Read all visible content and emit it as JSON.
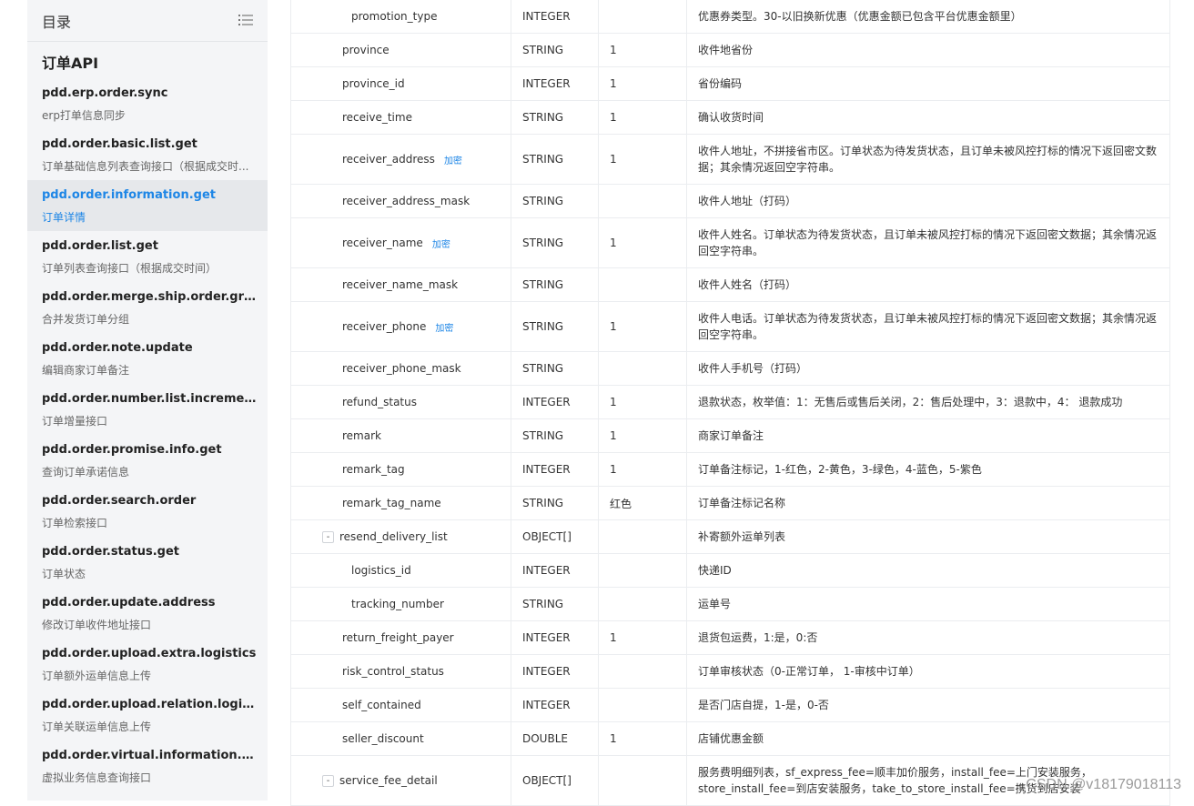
{
  "sidebar": {
    "title": "目录",
    "toc_icon": "list-icon",
    "group_title": "订单API",
    "items": [
      {
        "name": "pdd.erp.order.sync",
        "desc": "erp打单信息同步",
        "active": false
      },
      {
        "name": "pdd.order.basic.list.get",
        "desc": "订单基础信息列表查询接口（根据成交时...",
        "active": false
      },
      {
        "name": "pdd.order.information.get",
        "desc": "订单详情",
        "active": true
      },
      {
        "name": "pdd.order.list.get",
        "desc": "订单列表查询接口（根据成交时间）",
        "active": false
      },
      {
        "name": "pdd.order.merge.ship.order.group",
        "desc": "合并发货订单分组",
        "active": false
      },
      {
        "name": "pdd.order.note.update",
        "desc": "编辑商家订单备注",
        "active": false
      },
      {
        "name": "pdd.order.number.list.increment....",
        "desc": "订单增量接口",
        "active": false
      },
      {
        "name": "pdd.order.promise.info.get",
        "desc": "查询订单承诺信息",
        "active": false
      },
      {
        "name": "pdd.order.search.order",
        "desc": "订单检索接口",
        "active": false
      },
      {
        "name": "pdd.order.status.get",
        "desc": "订单状态",
        "active": false
      },
      {
        "name": "pdd.order.update.address",
        "desc": "修改订单收件地址接口",
        "active": false
      },
      {
        "name": "pdd.order.upload.extra.logistics",
        "desc": "订单额外运单信息上传",
        "active": false
      },
      {
        "name": "pdd.order.upload.relation.logistics",
        "desc": "订单关联运单信息上传",
        "active": false
      },
      {
        "name": "pdd.order.virtual.information.get",
        "desc": "虚拟业务信息查询接口",
        "active": false
      }
    ]
  },
  "table": {
    "rows": [
      {
        "name": "promotion_type",
        "level": 2,
        "type": "INTEGER",
        "req": "",
        "desc": "优惠券类型。30-以旧换新优惠（优惠金额已包含平台优惠金额里）"
      },
      {
        "name": "province",
        "level": 1,
        "type": "STRING",
        "req": "1",
        "desc": "收件地省份"
      },
      {
        "name": "province_id",
        "level": 1,
        "type": "INTEGER",
        "req": "1",
        "desc": "省份编码"
      },
      {
        "name": "receive_time",
        "level": 1,
        "type": "STRING",
        "req": "1",
        "desc": "确认收货时间"
      },
      {
        "name": "receiver_address",
        "level": 1,
        "badge": "加密",
        "type": "STRING",
        "req": "1",
        "desc": "收件人地址，不拼接省市区。订单状态为待发货状态，且订单未被风控打标的情况下返回密文数据；其余情况返回空字符串。",
        "tall": true
      },
      {
        "name": "receiver_address_mask",
        "level": 1,
        "type": "STRING",
        "req": "",
        "desc": "收件人地址（打码）"
      },
      {
        "name": "receiver_name",
        "level": 1,
        "badge": "加密",
        "type": "STRING",
        "req": "1",
        "desc": "收件人姓名。订单状态为待发货状态，且订单未被风控打标的情况下返回密文数据；其余情况返回空字符串。",
        "tall": true
      },
      {
        "name": "receiver_name_mask",
        "level": 1,
        "type": "STRING",
        "req": "",
        "desc": "收件人姓名（打码）"
      },
      {
        "name": "receiver_phone",
        "level": 1,
        "badge": "加密",
        "type": "STRING",
        "req": "1",
        "desc": "收件人电话。订单状态为待发货状态，且订单未被风控打标的情况下返回密文数据；其余情况返回空字符串。",
        "tall": true
      },
      {
        "name": "receiver_phone_mask",
        "level": 1,
        "type": "STRING",
        "req": "",
        "desc": "收件人手机号（打码）"
      },
      {
        "name": "refund_status",
        "level": 1,
        "type": "INTEGER",
        "req": "1",
        "desc": "退款状态，枚举值：1：无售后或售后关闭，2：售后处理中，3：退款中，4： 退款成功"
      },
      {
        "name": "remark",
        "level": 1,
        "type": "STRING",
        "req": "1",
        "desc": "商家订单备注"
      },
      {
        "name": "remark_tag",
        "level": 1,
        "type": "INTEGER",
        "req": "1",
        "desc": "订单备注标记，1-红色，2-黄色，3-绿色，4-蓝色，5-紫色"
      },
      {
        "name": "remark_tag_name",
        "level": 1,
        "type": "STRING",
        "req": "红色",
        "desc": "订单备注标记名称"
      },
      {
        "name": "resend_delivery_list",
        "level": 1,
        "toggle": "-",
        "type": "OBJECT[]",
        "req": "",
        "desc": "补寄额外运单列表"
      },
      {
        "name": "logistics_id",
        "level": 2,
        "type": "INTEGER",
        "req": "",
        "desc": "快递ID"
      },
      {
        "name": "tracking_number",
        "level": 2,
        "type": "STRING",
        "req": "",
        "desc": "运单号"
      },
      {
        "name": "return_freight_payer",
        "level": 1,
        "type": "INTEGER",
        "req": "1",
        "desc": "退货包运费，1:是，0:否"
      },
      {
        "name": "risk_control_status",
        "level": 1,
        "type": "INTEGER",
        "req": "",
        "desc": "订单审核状态（0-正常订单， 1-审核中订单）"
      },
      {
        "name": "self_contained",
        "level": 1,
        "type": "INTEGER",
        "req": "",
        "desc": "是否门店自提，1-是，0-否"
      },
      {
        "name": "seller_discount",
        "level": 1,
        "type": "DOUBLE",
        "req": "1",
        "desc": "店铺优惠金额"
      },
      {
        "name": "service_fee_detail",
        "level": 1,
        "toggle": "-",
        "type": "OBJECT[]",
        "req": "",
        "desc": "服务费明细列表，sf_express_fee=顺丰加价服务，install_fee=上门安装服务，store_install_fee=到店安装服务，take_to_store_install_fee=携货到店安装",
        "tall": true
      }
    ]
  },
  "watermark": "CSDN @v18179018113"
}
